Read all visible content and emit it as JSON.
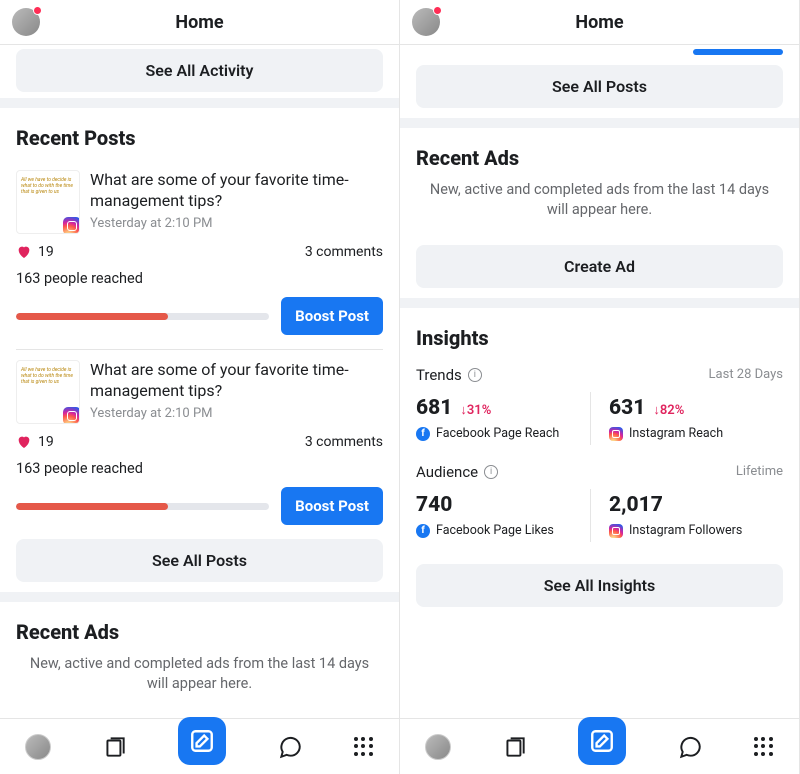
{
  "header": {
    "title": "Home"
  },
  "left": {
    "see_activity": "See All Activity",
    "recent_posts_title": "Recent Posts",
    "see_all_posts": "See All Posts",
    "recent_ads_title": "Recent Ads",
    "recent_ads_sub": "New, active and completed ads from the last 14 days will appear here.",
    "posts": [
      {
        "thumb_text": "All we have to decide is what to do with the time that is given to us",
        "title": "What are some of your favorite time-management tips?",
        "time": "Yesterday at 2:10 PM",
        "likes": "19",
        "comments": "3 comments",
        "reach": "163 people reached",
        "reach_pct": 60,
        "boost": "Boost Post"
      },
      {
        "thumb_text": "All we have to decide is what to do with the time that is given to us",
        "title": "What are some of your favorite time-management tips?",
        "time": "Yesterday at 2:10 PM",
        "likes": "19",
        "comments": "3 comments",
        "reach": "163 people reached",
        "reach_pct": 60,
        "boost": "Boost Post"
      }
    ]
  },
  "right": {
    "see_all_posts": "See All Posts",
    "recent_ads_title": "Recent Ads",
    "recent_ads_sub": "New, active and completed ads from the last 14 days will appear here.",
    "create_ad": "Create Ad",
    "insights_title": "Insights",
    "trends_label": "Trends",
    "trends_period": "Last 28 Days",
    "audience_label": "Audience",
    "audience_period": "Lifetime",
    "see_all_insights": "See All Insights",
    "trends": [
      {
        "value": "681",
        "delta": "↓31%",
        "label": "Facebook Page Reach",
        "net": "fb"
      },
      {
        "value": "631",
        "delta": "↓82%",
        "label": "Instagram Reach",
        "net": "ig"
      }
    ],
    "audience": [
      {
        "value": "740",
        "label": "Facebook Page Likes",
        "net": "fb"
      },
      {
        "value": "2,017",
        "label": "Instagram Followers",
        "net": "ig"
      }
    ]
  }
}
